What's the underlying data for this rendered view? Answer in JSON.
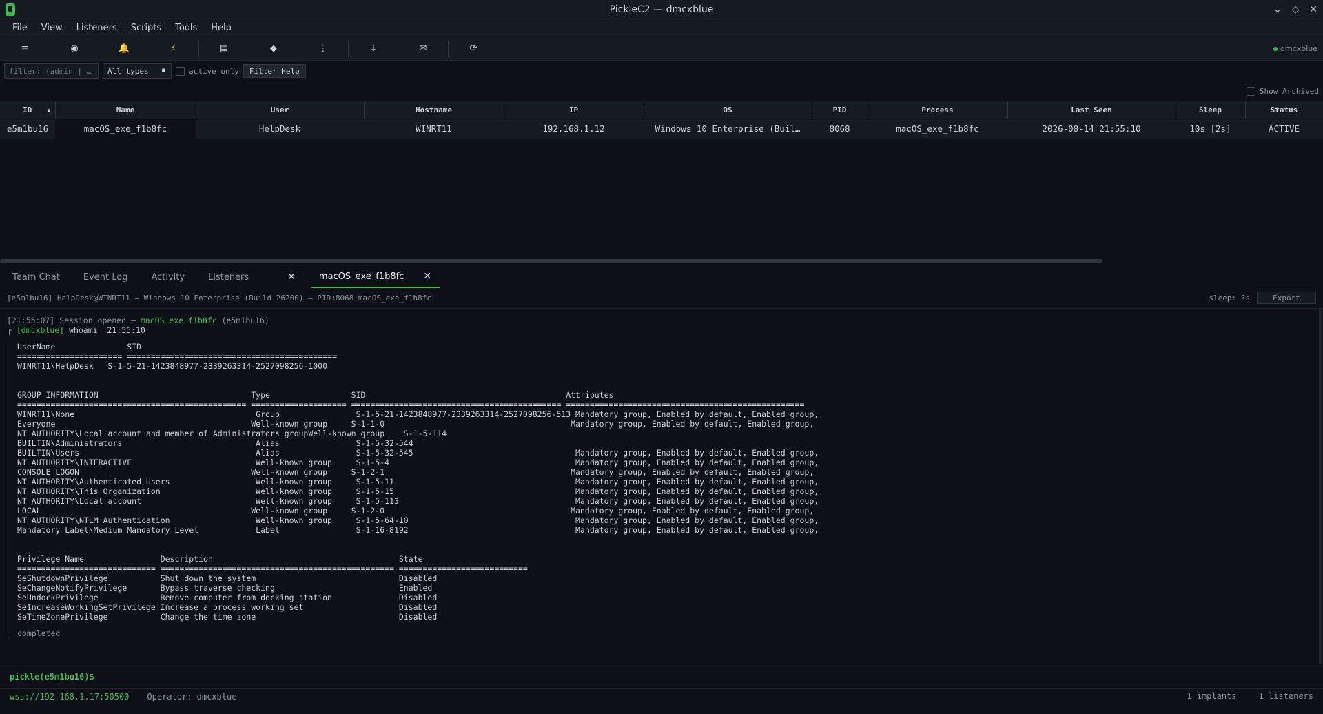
{
  "window": {
    "title": "PickleC2 — dmcxblue"
  },
  "menu": [
    "File",
    "View",
    "Listeners",
    "Scripts",
    "Tools",
    "Help"
  ],
  "toolbar": {
    "icons": [
      "menu-icon",
      "record-icon",
      "bell-icon",
      "bolt-icon",
      "list-icon",
      "diamond-icon",
      "more-icon",
      "download-icon",
      "mail-icon",
      "refresh-icon"
    ],
    "operator": "dmcxblue"
  },
  "filter": {
    "placeholder": "filter: (admin | …",
    "type_select": "All types",
    "active_only_label": "active only",
    "help_button": "Filter Help",
    "show_archived_label": "Show Archived"
  },
  "table": {
    "columns": [
      "ID",
      "Name",
      "User",
      "Hostname",
      "IP",
      "OS",
      "PID",
      "Process",
      "Last Seen",
      "Sleep",
      "Status"
    ],
    "rows": [
      {
        "id": "e5m1bu16",
        "name": "macOS_exe_f1b8fc",
        "user": "HelpDesk",
        "hostname": "WINRT11",
        "ip": "192.168.1.12",
        "os": "Windows 10 Enterprise (Buil…",
        "pid": "8068",
        "process": "macOS_exe_f1b8fc",
        "last_seen": "2026-08-14 21:55:10",
        "sleep": "10s  [2s]",
        "status": "ACTIVE"
      }
    ]
  },
  "tabs": [
    {
      "label": "Team Chat",
      "closable": false,
      "active": false
    },
    {
      "label": "Event Log",
      "closable": false,
      "active": false
    },
    {
      "label": "Activity",
      "closable": false,
      "active": false
    },
    {
      "label": "Listeners",
      "closable": true,
      "active": false
    },
    {
      "label": "macOS_exe_f1b8fc",
      "closable": true,
      "active": true
    }
  ],
  "session": {
    "info": "[e5m1bu16] HelpDesk@WINRT11 — Windows 10 Enterprise (Build 26200) — PID:8068:macOS_exe_f1b8fc",
    "sleep": "sleep: ?s",
    "export_label": "Export"
  },
  "console": {
    "opened_prefix": "[21:55:07] Session opened — ",
    "opened_name": "macOS_exe_f1b8fc",
    "opened_suffix": " (e5m1bu16)",
    "cmd_operator": "[dmcxblue]",
    "cmd_text": " whoami  21:55:10",
    "output": "UserName               SID\n====================== ============================================\nWINRT11\\HelpDesk   S-1-5-21-1423848977-2339263314-2527098256-1000\n\n\nGROUP INFORMATION                                Type                 SID                                          Attributes\n================================================ ==================== ============================================ ==================================================\nWINRT11\\None                                      Group                S-1-5-21-1423848977-2339263314-2527098256-513 Mandatory group, Enabled by default, Enabled group,\nEveryone                                         Well-known group     S-1-1-0                                       Mandatory group, Enabled by default, Enabled group,\nNT AUTHORITY\\Local account and member of Administrators groupWell-known group    S-1-5-114\nBUILTIN\\Administrators                            Alias                S-1-5-32-544\nBUILTIN\\Users                                     Alias                S-1-5-32-545                                  Mandatory group, Enabled by default, Enabled group,\nNT AUTHORITY\\INTERACTIVE                          Well-known group     S-1-5-4                                       Mandatory group, Enabled by default, Enabled group,\nCONSOLE LOGON                                    Well-known group     S-1-2-1                                       Mandatory group, Enabled by default, Enabled group,\nNT AUTHORITY\\Authenticated Users                  Well-known group     S-1-5-11                                      Mandatory group, Enabled by default, Enabled group,\nNT AUTHORITY\\This Organization                    Well-known group     S-1-5-15                                      Mandatory group, Enabled by default, Enabled group,\nNT AUTHORITY\\Local account                        Well-known group     S-1-5-113                                     Mandatory group, Enabled by default, Enabled group,\nLOCAL                                            Well-known group     S-1-2-0                                       Mandatory group, Enabled by default, Enabled group,\nNT AUTHORITY\\NTLM Authentication                  Well-known group     S-1-5-64-10                                   Mandatory group, Enabled by default, Enabled group,\nMandatory Label\\Medium Mandatory Level            Label                S-1-16-8192                                   Mandatory group, Enabled by default, Enabled group,\n\n\nPrivilege Name                Description                                       State\n============================= ================================================= ===========================\nSeShutdownPrivilege           Shut down the system                              Disabled\nSeChangeNotifyPrivilege       Bypass traverse checking                          Enabled\nSeUndockPrivilege             Remove computer from docking station              Disabled\nSeIncreaseWorkingSetPrivilege Increase a process working set                    Disabled\nSeTimeZonePrivilege           Change the time zone                              Disabled",
    "completed": "completed"
  },
  "prompt": {
    "text": "pickle(e5m1bu16)$",
    "value": ""
  },
  "statusbar": {
    "ws": "wss://192.168.1.17:50500",
    "operator": "Operator: dmcxblue",
    "implants": "1 implants",
    "listeners": "1 listeners"
  },
  "colors": {
    "accent": "#3fb950",
    "background": "#0d1117",
    "panel": "#161b22"
  }
}
